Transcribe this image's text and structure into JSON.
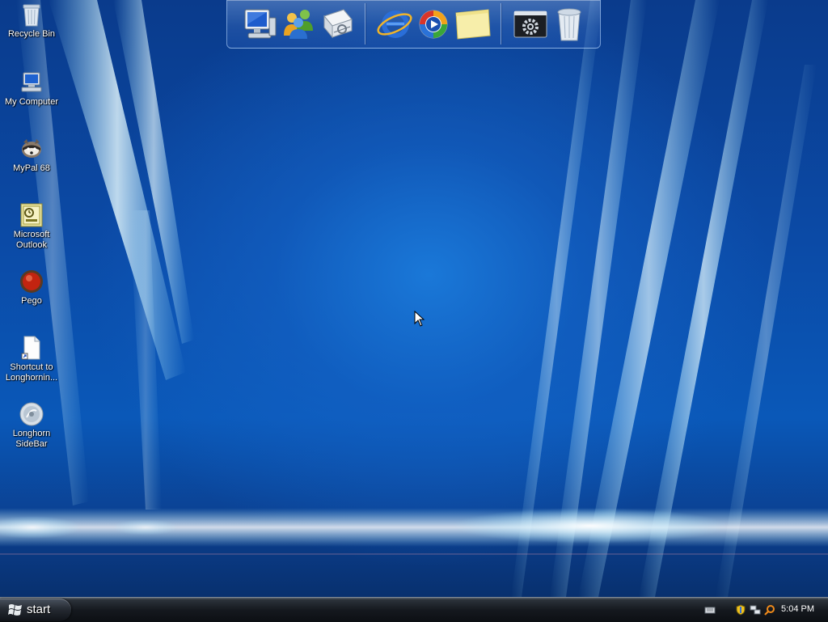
{
  "desktop": {
    "icons": [
      {
        "label": "Recycle Bin",
        "icon": "recycle-bin-icon"
      },
      {
        "label": "My Computer",
        "icon": "my-computer-icon"
      },
      {
        "label": "MyPal 68",
        "icon": "mypal-icon"
      },
      {
        "label": "Microsoft Outlook",
        "icon": "outlook-icon"
      },
      {
        "label": "Pego",
        "icon": "pego-icon"
      },
      {
        "label": "Shortcut to Longhornin...",
        "icon": "document-shortcut-icon"
      },
      {
        "label": "Longhorn SideBar",
        "icon": "sidebar-icon"
      }
    ]
  },
  "dock": {
    "items": [
      {
        "icon": "computer-icon"
      },
      {
        "icon": "users-icon"
      },
      {
        "icon": "network-folder-icon"
      },
      {
        "icon": "internet-explorer-icon"
      },
      {
        "icon": "media-player-icon"
      },
      {
        "icon": "notes-icon"
      },
      {
        "icon": "settings-gear-icon"
      },
      {
        "icon": "trash-bin-icon"
      }
    ]
  },
  "taskbar": {
    "start_label": "start",
    "clock": "5:04 PM",
    "tray_icons": [
      "keyboard-icon",
      "security-shield-icon",
      "network-icon",
      "search-icon"
    ]
  },
  "colors": {
    "desktop_blue": "#0b4aa6",
    "taskbar": "#15191f",
    "label_text": "#ffffff"
  }
}
